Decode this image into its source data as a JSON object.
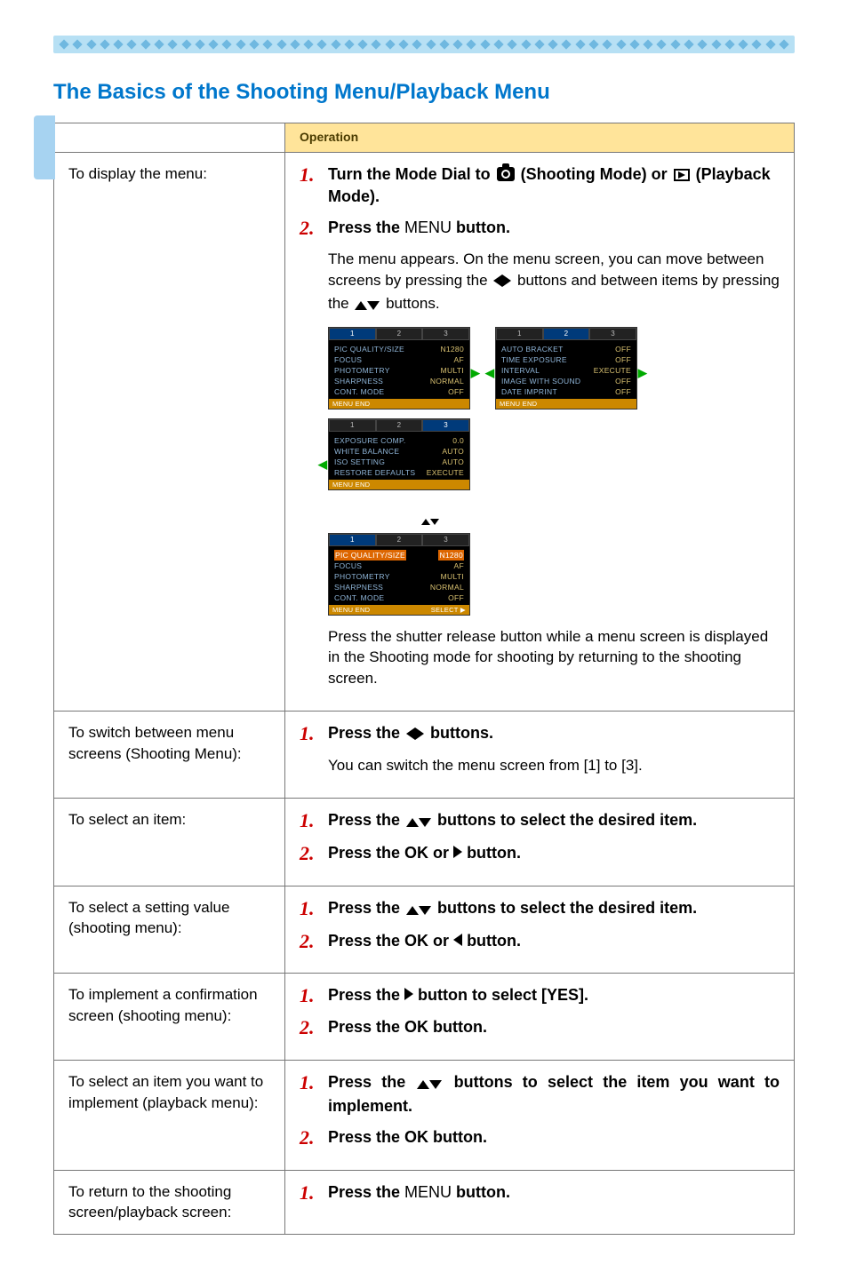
{
  "heading": "The Basics of the Shooting Menu/Playback Menu",
  "table_header_operation": "Operation",
  "rows": {
    "display_menu": {
      "label": "To display the menu:",
      "step1_pre": "Turn the Mode Dial to ",
      "step1_mid": " (Shooting Mode) or ",
      "step1_post": " (Playback Mode).",
      "step2_pre": "Press the ",
      "step2_menu": "MENU",
      "step2_post": " button.",
      "body1a": "The menu appears. On the menu screen, you can move between screens by pressing the ",
      "body1b": " buttons and between items by pressing the ",
      "body1c": " buttons.",
      "body2": "Press the shutter release button while a menu screen is displayed in the Shooting mode for shooting by returning to the shooting screen."
    },
    "switch_screens": {
      "label": "To switch between menu screens (Shooting Menu):",
      "step1_pre": "Press the ",
      "step1_post": " buttons.",
      "body": "You can switch the menu screen from [1] to [3]."
    },
    "select_item": {
      "label": "To select an item:",
      "step1_pre": "Press the ",
      "step1_post": " buttons to select the desired item.",
      "step2_pre": "Press the ",
      "step2_ok": "OK",
      "step2_mid": " or ",
      "step2_post": " button."
    },
    "select_value": {
      "label": "To select a setting value (shooting menu):",
      "step1_pre": "Press the ",
      "step1_post": " buttons to select the desired item.",
      "step2_pre": "Press the ",
      "step2_ok": "OK",
      "step2_mid": " or ",
      "step2_post": " button."
    },
    "confirm": {
      "label": "To implement a confirmation screen (shooting menu):",
      "step1_pre": "Press the ",
      "step1_post": " button to select [YES].",
      "step2_pre": "Press the ",
      "step2_ok": "OK",
      "step2_post": " button."
    },
    "playback_item": {
      "label": "To select an item you want to implement (playback menu):",
      "step1_pre": "Press the ",
      "step1_post": " buttons to select the item you want to implement.",
      "step2_pre": "Press the ",
      "step2_ok": "OK",
      "step2_post": " button."
    },
    "return": {
      "label": "To return to the shooting screen/playback screen:",
      "step1_pre": "Press the ",
      "step1_menu": "MENU",
      "step1_post": " button."
    }
  },
  "screenshots": {
    "screen1": {
      "active_tab": 1,
      "items": [
        {
          "k": "PIC QUALITY/SIZE",
          "v": "N1280"
        },
        {
          "k": "FOCUS",
          "v": "AF"
        },
        {
          "k": "PHOTOMETRY",
          "v": "MULTI"
        },
        {
          "k": "SHARPNESS",
          "v": "NORMAL"
        },
        {
          "k": "CONT. MODE",
          "v": "OFF"
        }
      ],
      "footer_left": "MENU END",
      "footer_right": ""
    },
    "screen2": {
      "active_tab": 2,
      "items": [
        {
          "k": "AUTO BRACKET",
          "v": "OFF"
        },
        {
          "k": "TIME EXPOSURE",
          "v": "OFF"
        },
        {
          "k": "INTERVAL",
          "v": "EXECUTE"
        },
        {
          "k": "IMAGE WITH SOUND",
          "v": "OFF"
        },
        {
          "k": "DATE IMPRINT",
          "v": "OFF"
        }
      ],
      "footer_left": "MENU END",
      "footer_right": ""
    },
    "screen3": {
      "active_tab": 3,
      "items": [
        {
          "k": "EXPOSURE COMP.",
          "v": "0.0"
        },
        {
          "k": "WHITE BALANCE",
          "v": "AUTO"
        },
        {
          "k": "ISO SETTING",
          "v": "AUTO"
        },
        {
          "k": "RESTORE DEFAULTS",
          "v": "EXECUTE"
        }
      ],
      "footer_left": "MENU END",
      "footer_right": ""
    },
    "screen4": {
      "active_tab": 1,
      "items": [
        {
          "k": "PIC QUALITY/SIZE",
          "v": "N1280",
          "sel": true
        },
        {
          "k": "FOCUS",
          "v": "AF"
        },
        {
          "k": "PHOTOMETRY",
          "v": "MULTI"
        },
        {
          "k": "SHARPNESS",
          "v": "NORMAL"
        },
        {
          "k": "CONT. MODE",
          "v": "OFF"
        }
      ],
      "footer_left": "MENU END",
      "footer_right": "SELECT ▶"
    }
  }
}
